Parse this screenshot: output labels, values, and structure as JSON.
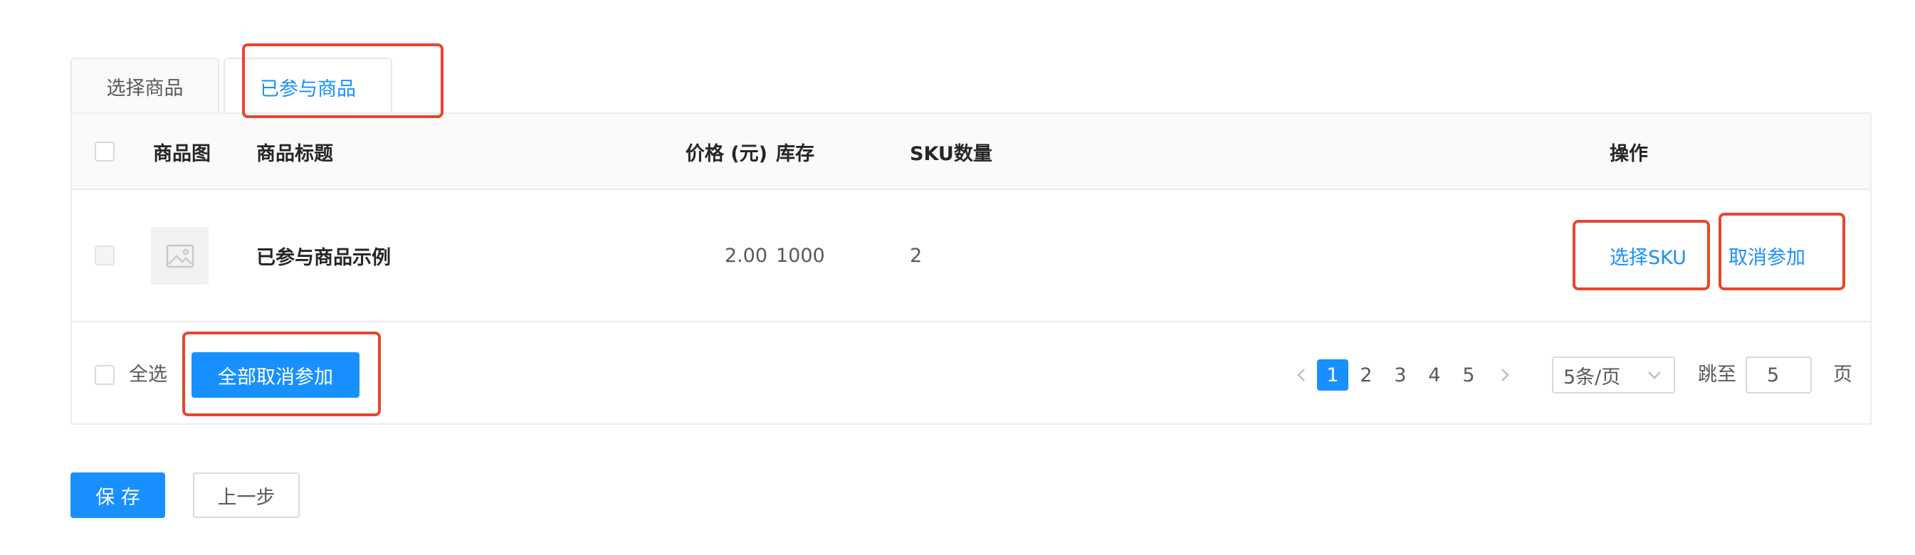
{
  "tabs": [
    {
      "label": "选择商品",
      "active": false
    },
    {
      "label": "已参与商品",
      "active": true
    }
  ],
  "table": {
    "columns": {
      "image": "商品图",
      "title": "商品标题",
      "price": "价格 (元)",
      "stock": "库存",
      "sku_count": "SKU数量",
      "actions": "操作"
    },
    "rows": [
      {
        "image_icon": "image-placeholder-icon",
        "title": "已参与商品示例",
        "price": "2.00",
        "stock": "1000",
        "sku_count": "2",
        "actions": {
          "select_sku": "选择SKU",
          "cancel": "取消参加"
        }
      }
    ]
  },
  "footer": {
    "select_all": "全选",
    "cancel_all_button": "全部取消参加",
    "pagination": {
      "pages": [
        "1",
        "2",
        "3",
        "4",
        "5"
      ],
      "current": "1",
      "page_size": "5条/页",
      "jump_to_label": "跳至",
      "jump_value": "5",
      "page_suffix": "页"
    }
  },
  "buttons": {
    "save": "保 存",
    "prev_step": "上一步"
  },
  "colors": {
    "primary": "#1890ff",
    "annotation": "#e8462c"
  }
}
